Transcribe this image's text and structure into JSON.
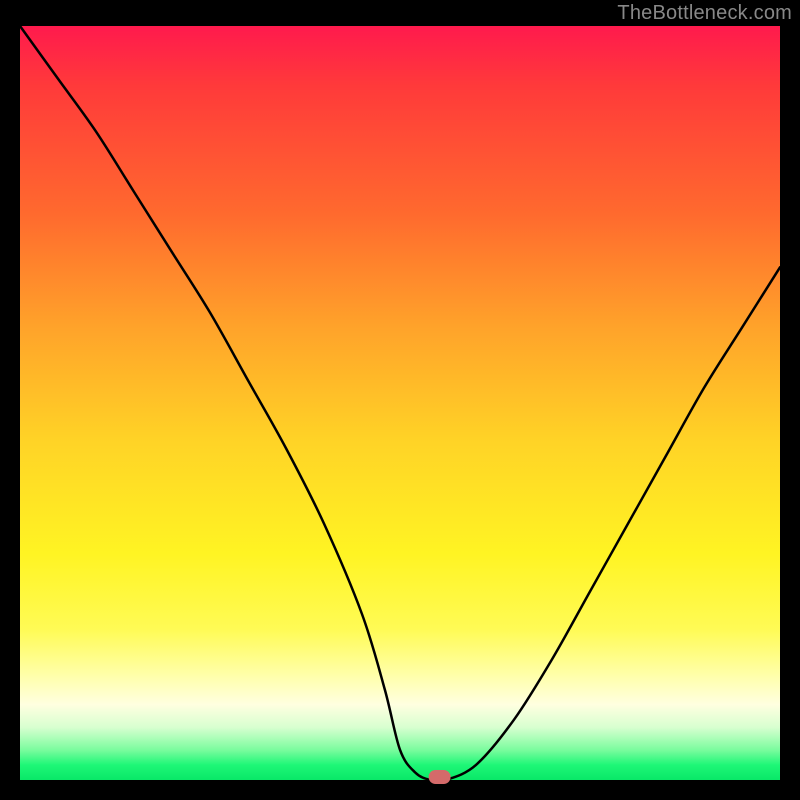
{
  "attribution": "TheBottleneck.com",
  "chart_data": {
    "type": "line",
    "title": "",
    "xlabel": "",
    "ylabel": "",
    "xlim": [
      0,
      100
    ],
    "ylim": [
      0,
      100
    ],
    "grid": false,
    "legend": false,
    "series": [
      {
        "name": "bottleneck-curve",
        "x": [
          0,
          5,
          10,
          15,
          20,
          25,
          30,
          35,
          40,
          45,
          48,
          50,
          52,
          54,
          56,
          60,
          65,
          70,
          75,
          80,
          85,
          90,
          95,
          100
        ],
        "y": [
          100,
          93,
          86,
          78,
          70,
          62,
          53,
          44,
          34,
          22,
          12,
          4,
          1,
          0,
          0,
          2,
          8,
          16,
          25,
          34,
          43,
          52,
          60,
          68
        ]
      }
    ],
    "marker": {
      "x_center": 55.2,
      "y": 0.0,
      "width": 3.0,
      "color": "#d46a6a"
    },
    "background_gradient": {
      "stops": [
        {
          "pos": 0.0,
          "color": "#ff1a4d"
        },
        {
          "pos": 0.25,
          "color": "#ff6a2e"
        },
        {
          "pos": 0.55,
          "color": "#ffd326"
        },
        {
          "pos": 0.8,
          "color": "#fffb55"
        },
        {
          "pos": 0.92,
          "color": "#ffffe0"
        },
        {
          "pos": 1.0,
          "color": "#09e868"
        }
      ]
    }
  }
}
